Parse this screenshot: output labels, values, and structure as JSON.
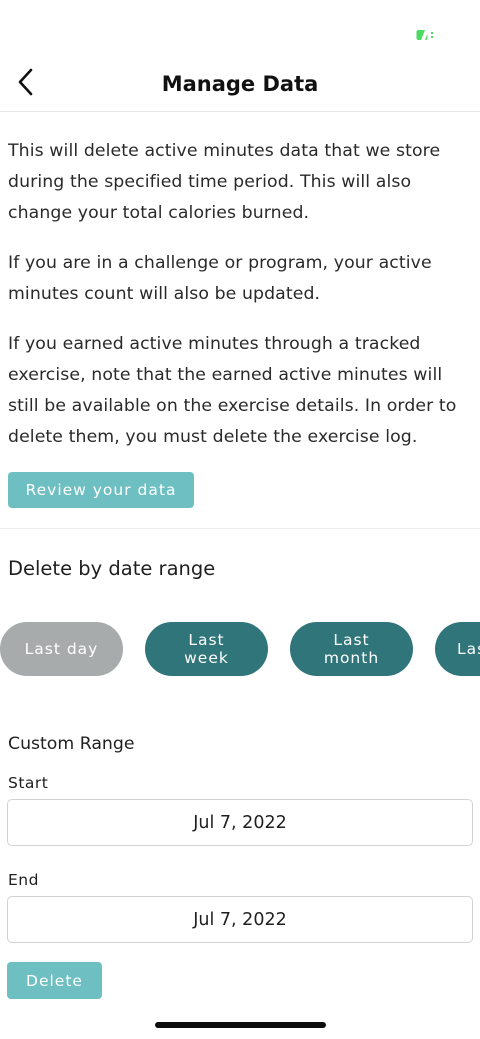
{
  "status_bar": {
    "battery_icon": "battery-icon",
    "battery_color": "#4cd964"
  },
  "header": {
    "title": "Manage Data",
    "back_icon": "chevron-left-icon"
  },
  "content": {
    "paragraphs": [
      "This will delete active minutes data that we store during the specified time period. This will also change your total calories burned.",
      "If you are in a challenge or program, your active minutes count will also be updated.",
      "If you earned active minutes through a tracked exercise, note that the earned active minutes will still be available on the exercise details. In order to delete them, you must delete the exercise log."
    ],
    "review_button_label": "Review your data"
  },
  "date_range": {
    "title": "Delete by date range",
    "chips": [
      {
        "line1": "Last day",
        "line2": "",
        "state": "inactive"
      },
      {
        "line1": "Last",
        "line2": "week",
        "state": "active"
      },
      {
        "line1": "Last",
        "line2": "month",
        "state": "active"
      },
      {
        "line1": "Las",
        "line2": "",
        "state": "active"
      }
    ]
  },
  "custom_range": {
    "title": "Custom Range",
    "start_label": "Start",
    "start_value": "Jul 7, 2022",
    "end_label": "End",
    "end_value": "Jul 7, 2022",
    "delete_label": "Delete"
  },
  "colors": {
    "accent_light": "#6ebfc2",
    "accent_dark": "#2f7579",
    "chip_inactive": "#a7abac"
  }
}
